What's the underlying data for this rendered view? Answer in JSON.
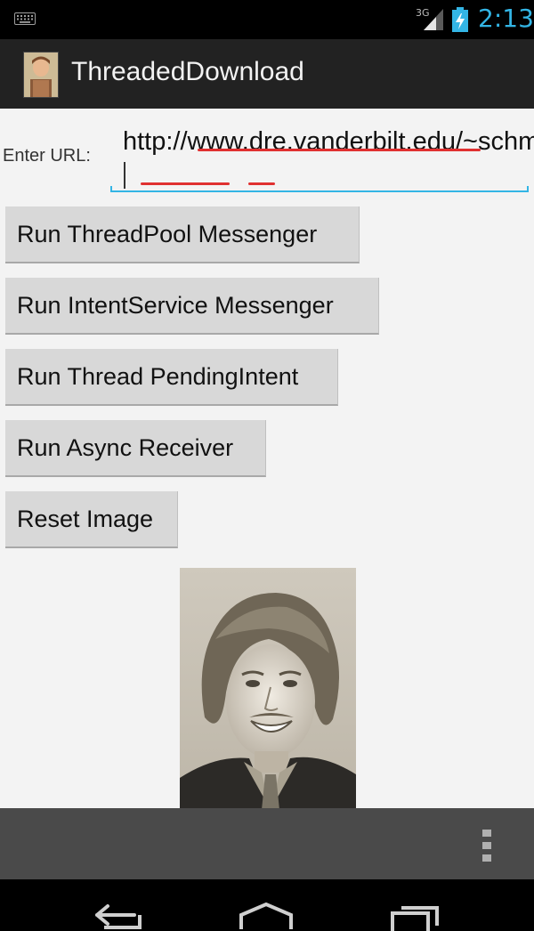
{
  "status_bar": {
    "network": "3G",
    "time": "2:13",
    "icons": [
      "keyboard-icon",
      "signal-icon",
      "battery-charging-icon"
    ]
  },
  "action_bar": {
    "title": "ThreadedDownload",
    "icon": "app-icon"
  },
  "form": {
    "url_label": "Enter URL:",
    "url_value": "http://www.dre.vanderbilt.edu/~schmidt/ka.png"
  },
  "buttons": {
    "threadpool": "Run ThreadPool Messenger",
    "intentservice": "Run IntentService Messenger",
    "pendingintent": "Run Thread PendingIntent",
    "async": "Run Async Receiver",
    "reset": "Reset Image"
  },
  "image": {
    "alt": "downloaded-photo"
  },
  "menu_bar": {
    "icon": "overflow-menu-icon"
  },
  "nav_bar": {
    "icons": [
      "back-icon",
      "home-icon",
      "recent-apps-icon"
    ]
  },
  "colors": {
    "accent": "#33b5e5",
    "action_bar": "#222222",
    "background": "#f3f3f3",
    "button": "#d8d8d8",
    "spell_underline": "#e03030",
    "menu_bar": "#4a4a4a"
  }
}
